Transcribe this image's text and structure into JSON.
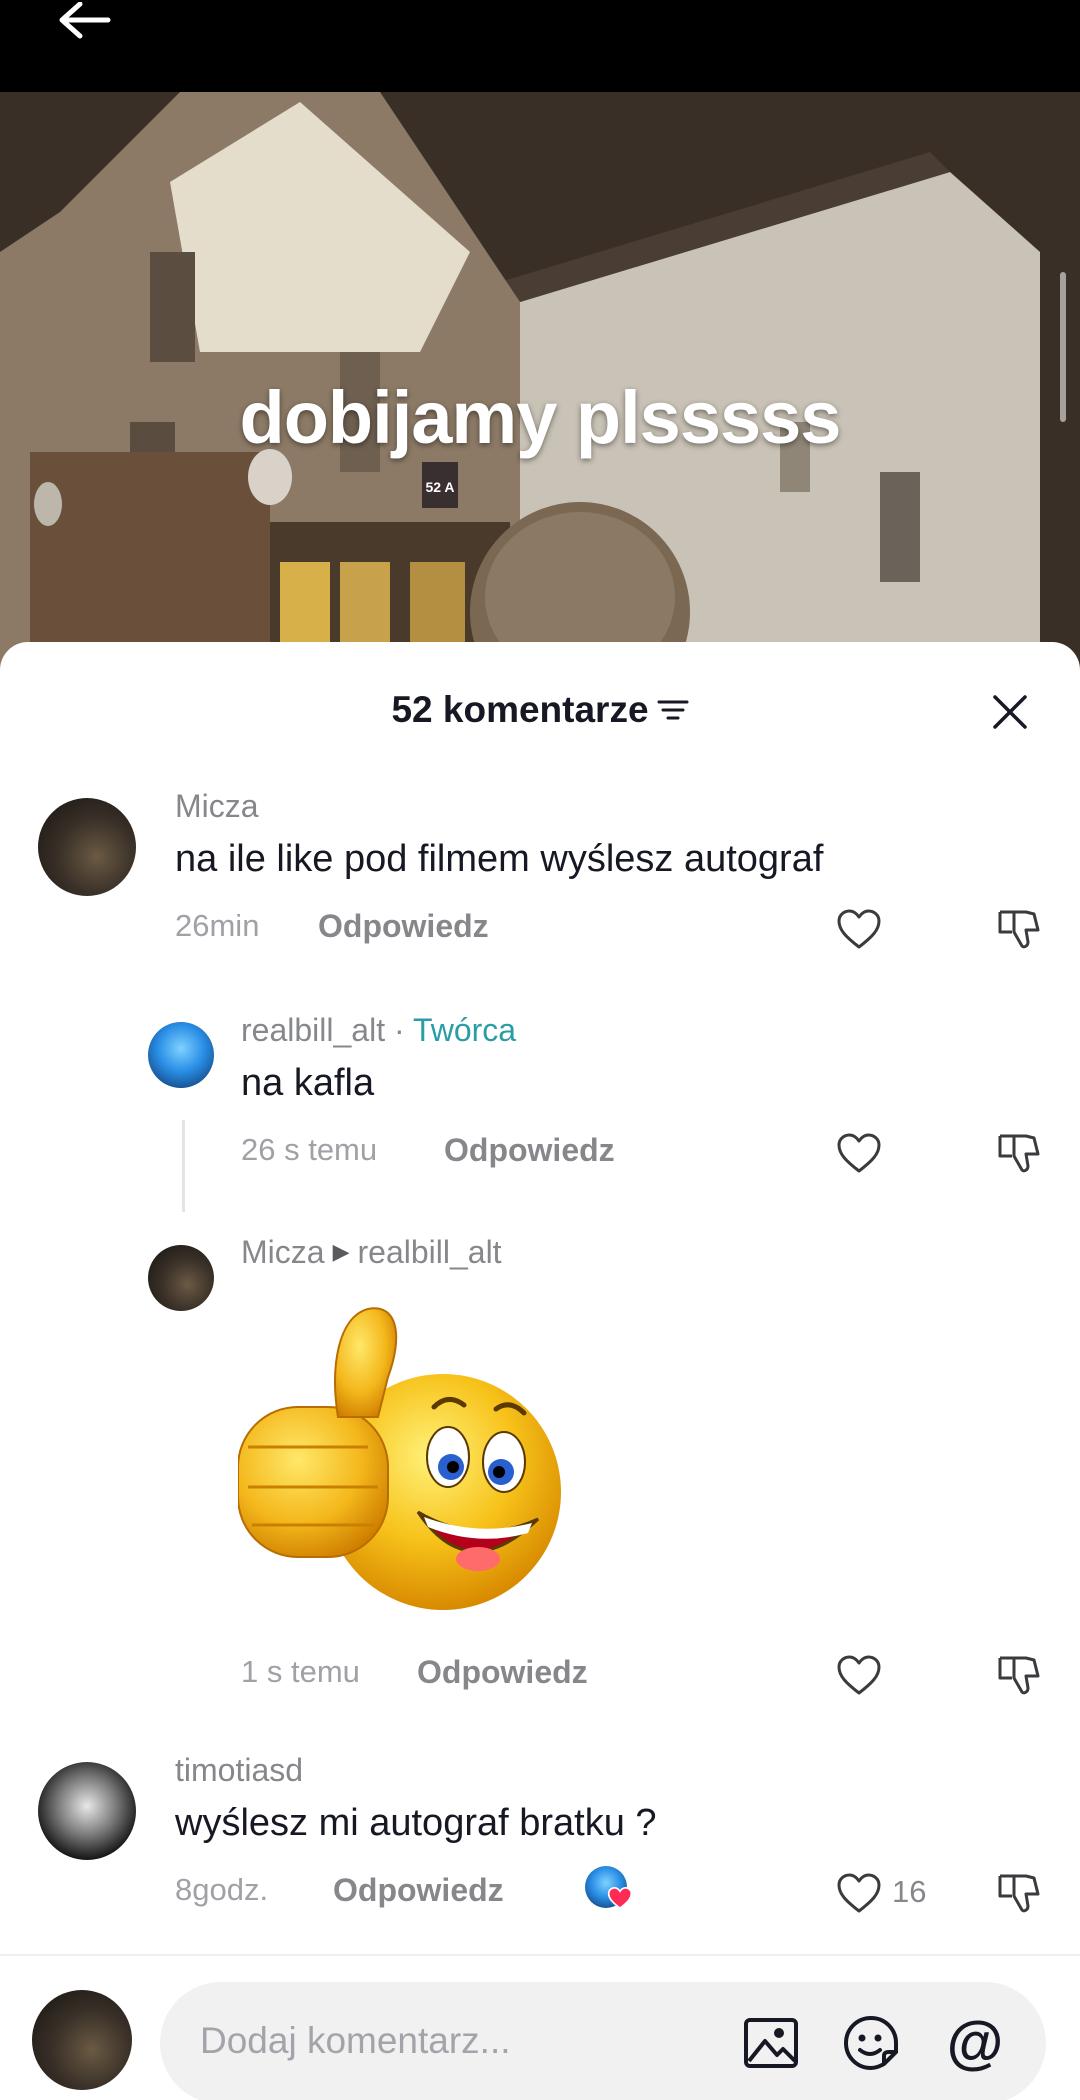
{
  "video": {
    "caption": "dobijamy plsssss",
    "sign_number": "52 A"
  },
  "sheet": {
    "title": "52 komentarze"
  },
  "comments": [
    {
      "username": "Micza",
      "text": "na ile like pod filmem wyślesz autograf",
      "time": "26min",
      "reply_label": "Odpowiedz"
    },
    {
      "username": "realbill_alt",
      "separator": " · ",
      "creator_label": "Twórca",
      "text": "na kafla",
      "time": "26 s temu",
      "reply_label": "Odpowiedz"
    },
    {
      "username": "Micza",
      "reply_to": "realbill_alt",
      "time": "1 s temu",
      "reply_label": "Odpowiedz"
    },
    {
      "username": "timotiasd",
      "text": "wyślesz mi autograf bratku ?",
      "time": "8godz.",
      "reply_label": "Odpowiedz",
      "likes": "16"
    }
  ],
  "composer": {
    "placeholder": "Dodaj komentarz..."
  },
  "icons": {
    "back": "arrow-left-icon",
    "sort": "sort-icon",
    "close": "close-icon",
    "like": "heart-icon",
    "dislike": "thumbs-down-icon",
    "image": "image-icon",
    "emoji": "emoji-icon",
    "mention": "at-icon"
  },
  "colors": {
    "creator_accent": "#2b9da5",
    "liked_heart": "#fe2c55"
  }
}
